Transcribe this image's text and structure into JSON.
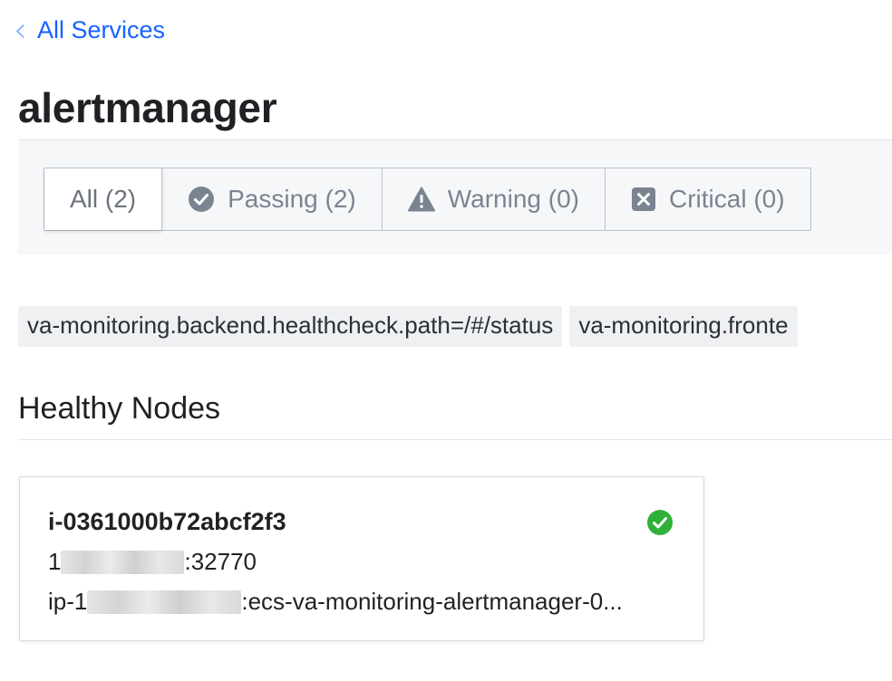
{
  "nav": {
    "back_label": "All Services"
  },
  "service": {
    "name": "alertmanager"
  },
  "filters": [
    {
      "label": "All (2)",
      "icon": "none",
      "active": true
    },
    {
      "label": "Passing (2)",
      "icon": "check-circle-icon",
      "active": false
    },
    {
      "label": "Warning (0)",
      "icon": "warning-triangle-icon",
      "active": false
    },
    {
      "label": "Critical (0)",
      "icon": "x-square-icon",
      "active": false
    }
  ],
  "tags": [
    "va-monitoring.backend.healthcheck.path=/#/status",
    "va-monitoring.fronte"
  ],
  "healthy_nodes": {
    "title": "Healthy Nodes",
    "nodes": [
      {
        "name": "i-0361000b72abcf2f3",
        "address_prefix": "1",
        "address_suffix": ":32770",
        "host_prefix": "ip-1",
        "host_suffix": ":ecs-va-monitoring-alertmanager-0...",
        "status": "passing"
      }
    ]
  },
  "colors": {
    "link": "#1563ff",
    "passing": "#2eb039",
    "icon_gray": "#7a8491",
    "filter_bg": "#f6f7f9",
    "tag_bg": "#eef0f2"
  }
}
